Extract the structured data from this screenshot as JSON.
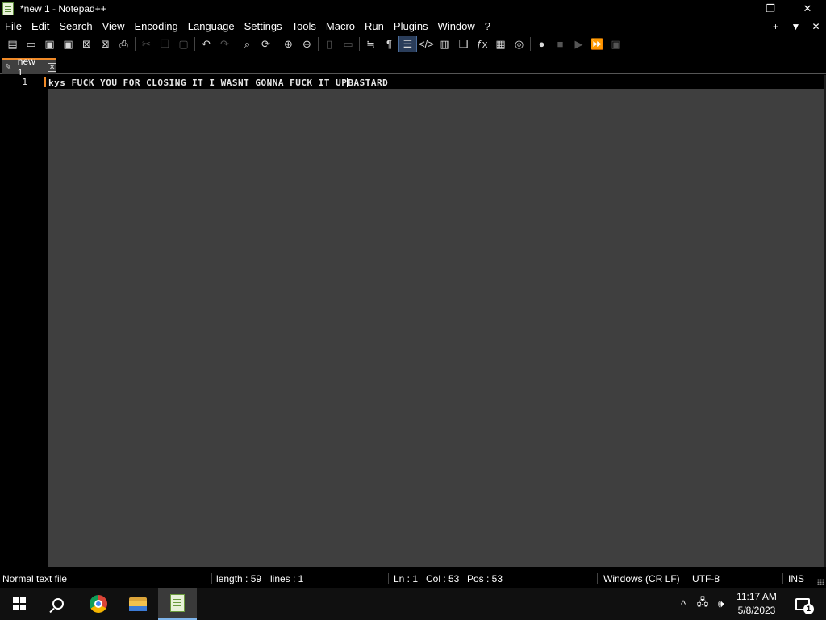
{
  "window": {
    "title": "*new 1 - Notepad++",
    "icon": "notepadpp-icon",
    "controls": {
      "minimize": "—",
      "restore": "❐",
      "close": "✕"
    }
  },
  "menu": {
    "items": [
      "File",
      "Edit",
      "Search",
      "View",
      "Encoding",
      "Language",
      "Settings",
      "Tools",
      "Macro",
      "Run",
      "Plugins",
      "Window",
      "?"
    ],
    "right": {
      "new_tab": "+",
      "list": "▼",
      "close": "✕"
    }
  },
  "toolbar": {
    "icons": [
      {
        "name": "new-file-icon",
        "glyph": "▤",
        "enabled": true
      },
      {
        "name": "open-file-icon",
        "glyph": "▭",
        "enabled": true
      },
      {
        "name": "save-icon",
        "glyph": "▣",
        "enabled": true
      },
      {
        "name": "save-all-icon",
        "glyph": "▣",
        "enabled": true
      },
      {
        "name": "close-icon",
        "glyph": "⊠",
        "enabled": true
      },
      {
        "name": "close-all-icon",
        "glyph": "⊠",
        "enabled": true
      },
      {
        "name": "print-icon",
        "glyph": "⎙",
        "enabled": true
      },
      {
        "name": "sep"
      },
      {
        "name": "cut-icon",
        "glyph": "✂",
        "enabled": false
      },
      {
        "name": "copy-icon",
        "glyph": "❐",
        "enabled": false
      },
      {
        "name": "paste-icon",
        "glyph": "▢",
        "enabled": false
      },
      {
        "name": "sep"
      },
      {
        "name": "undo-icon",
        "glyph": "↶",
        "enabled": true
      },
      {
        "name": "redo-icon",
        "glyph": "↷",
        "enabled": false
      },
      {
        "name": "sep"
      },
      {
        "name": "find-icon",
        "glyph": "⌕",
        "enabled": true
      },
      {
        "name": "replace-icon",
        "glyph": "⟳",
        "enabled": true
      },
      {
        "name": "sep"
      },
      {
        "name": "zoom-in-icon",
        "glyph": "⊕",
        "enabled": true
      },
      {
        "name": "zoom-out-icon",
        "glyph": "⊖",
        "enabled": true
      },
      {
        "name": "sep"
      },
      {
        "name": "sync-vertical-icon",
        "glyph": "▯",
        "enabled": false
      },
      {
        "name": "sync-horizontal-icon",
        "glyph": "▭",
        "enabled": false
      },
      {
        "name": "sep"
      },
      {
        "name": "word-wrap-icon",
        "glyph": "≒",
        "enabled": true
      },
      {
        "name": "show-all-chars-icon",
        "glyph": "¶",
        "enabled": true
      },
      {
        "name": "indent-guide-icon",
        "glyph": "☰",
        "enabled": true,
        "active": true
      },
      {
        "name": "language-icon",
        "glyph": "</>",
        "enabled": true
      },
      {
        "name": "document-map-icon",
        "glyph": "▥",
        "enabled": true
      },
      {
        "name": "document-list-icon",
        "glyph": "❏",
        "enabled": true
      },
      {
        "name": "function-list-icon",
        "glyph": "ƒx",
        "enabled": true
      },
      {
        "name": "folder-as-workspace-icon",
        "glyph": "▦",
        "enabled": true
      },
      {
        "name": "monitoring-icon",
        "glyph": "◎",
        "enabled": true
      },
      {
        "name": "sep"
      },
      {
        "name": "macro-record-icon",
        "glyph": "●",
        "enabled": true
      },
      {
        "name": "macro-stop-icon",
        "glyph": "■",
        "enabled": false
      },
      {
        "name": "macro-play-icon",
        "glyph": "▶",
        "enabled": false
      },
      {
        "name": "macro-run-multiple-icon",
        "glyph": "⏩",
        "enabled": true
      },
      {
        "name": "macro-save-icon",
        "glyph": "▣",
        "enabled": false
      }
    ]
  },
  "tabs": [
    {
      "label": "new 1",
      "icon": "pencil-icon",
      "close": "✕",
      "modified": true
    }
  ],
  "editor": {
    "line_numbers": [
      "1"
    ],
    "text_before_caret": "kys FUCK YOU FOR CLOSING IT I WASNT GONNA FUCK IT UP",
    "text_after_caret": "BASTARD"
  },
  "status": {
    "file_type": "Normal text file",
    "length": "length : 59",
    "lines": "lines : 1",
    "ln": "Ln : 1",
    "col": "Col : 53",
    "pos": "Pos : 53",
    "eol": "Windows (CR LF)",
    "encoding": "UTF-8",
    "mode": "INS"
  },
  "taskbar": {
    "apps": [
      "start-icon",
      "search-icon",
      "chrome-icon",
      "file-explorer-icon",
      "notepadpp-icon"
    ],
    "tray": {
      "chevron": "^",
      "network": "🖧",
      "volume": "🕪"
    },
    "time": "11:17 AM",
    "date": "5/8/2023",
    "notification_count": "1"
  },
  "colors": {
    "tab_accent": "#f08a28",
    "editor_bg": "#3f3f3f",
    "chrome_bg": "#000000",
    "taskbar_bg": "#101010"
  }
}
